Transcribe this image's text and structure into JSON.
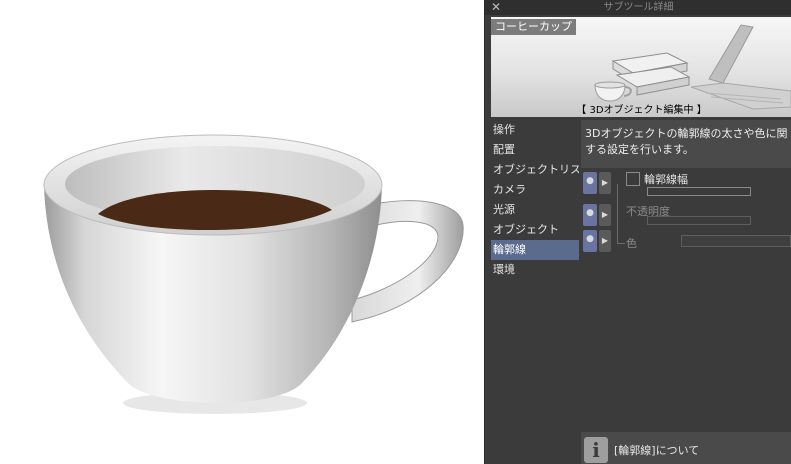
{
  "panel": {
    "title": "サブツール詳細",
    "close_icon": "✕",
    "preview": {
      "name_tag": "コーヒーカップ",
      "status": "【 3Dオブジェクト編集中 】"
    },
    "categories": [
      {
        "label": "操作",
        "selected": false
      },
      {
        "label": "配置",
        "selected": false
      },
      {
        "label": "オブジェクトリスト",
        "selected": false
      },
      {
        "label": "カメラ",
        "selected": false
      },
      {
        "label": "光源",
        "selected": false
      },
      {
        "label": "オブジェクト",
        "selected": false
      },
      {
        "label": "輪郭線",
        "selected": true
      },
      {
        "label": "環境",
        "selected": false
      }
    ],
    "description": "3Dオブジェクトの輪郭線の太さや色に関する設定を行います。",
    "properties": [
      {
        "label": "輪郭線幅",
        "enabled": true,
        "control": "checkbox-slider"
      },
      {
        "label": "不透明度",
        "enabled": false,
        "control": "slider"
      },
      {
        "label": "色",
        "enabled": false,
        "control": "color"
      }
    ],
    "info_bar": {
      "icon": "i",
      "text": "[輪郭線]について"
    }
  },
  "colors": {
    "panel_bg": "#3b3b3b",
    "selected_category": "#5b6b8e",
    "coffee": "#4a2a17"
  }
}
